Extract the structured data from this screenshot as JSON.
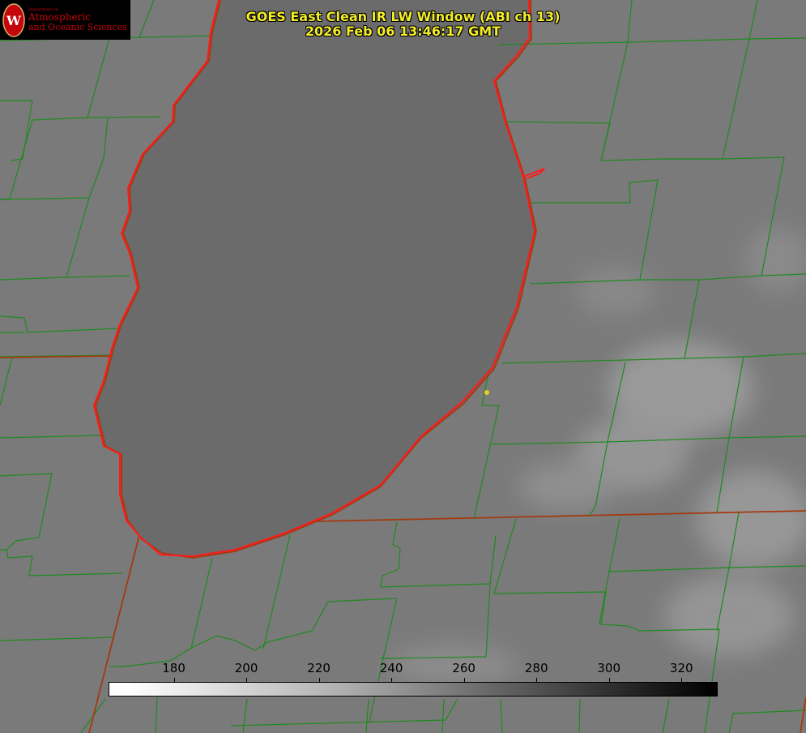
{
  "title": {
    "line1": "GOES East Clean IR LW Window (ABI ch 13)",
    "line2": "2026 Feb 06 13:46:17 GMT"
  },
  "logo": {
    "dept": "Department of",
    "line1": "Atmospheric",
    "line2": "and Oceanic Sciences",
    "seal_letter": "W"
  },
  "colorbar": {
    "min": 162,
    "max": 330,
    "ticks": [
      {
        "label": "180",
        "value": 180
      },
      {
        "label": "200",
        "value": 200
      },
      {
        "label": "220",
        "value": 220
      },
      {
        "label": "240",
        "value": 240
      },
      {
        "label": "260",
        "value": 260
      },
      {
        "label": "280",
        "value": 280
      },
      {
        "label": "300",
        "value": 300
      },
      {
        "label": "320",
        "value": 320
      }
    ]
  },
  "colors": {
    "county_lines": "#1f8a1f",
    "state_lines": "#a33a10",
    "coastline": "#ff1a1a",
    "title_text": "#f2ec2a",
    "logo_red": "#c5050c",
    "marker": "#e0d020"
  }
}
